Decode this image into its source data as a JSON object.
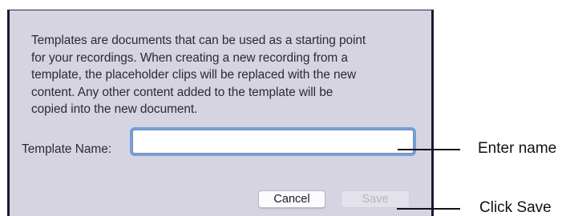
{
  "dialog": {
    "description": "Templates are documents that can be used as a starting point\nfor your recordings.  When creating a new recording from a\ntemplate, the placeholder clips will be replaced with the new\ncontent.  Any other content added to the template will be\ncopied into the new document.",
    "name_label": "Template Name:",
    "name_value": "",
    "cancel_label": "Cancel",
    "save_label": "Save",
    "save_enabled": false
  },
  "callouts": {
    "name": "Enter name",
    "save": "Click Save"
  },
  "colors": {
    "dialog_background": "#d6d4e1",
    "focus_ring": "#6f9fe0",
    "disabled_text": "#b4b3c2"
  }
}
